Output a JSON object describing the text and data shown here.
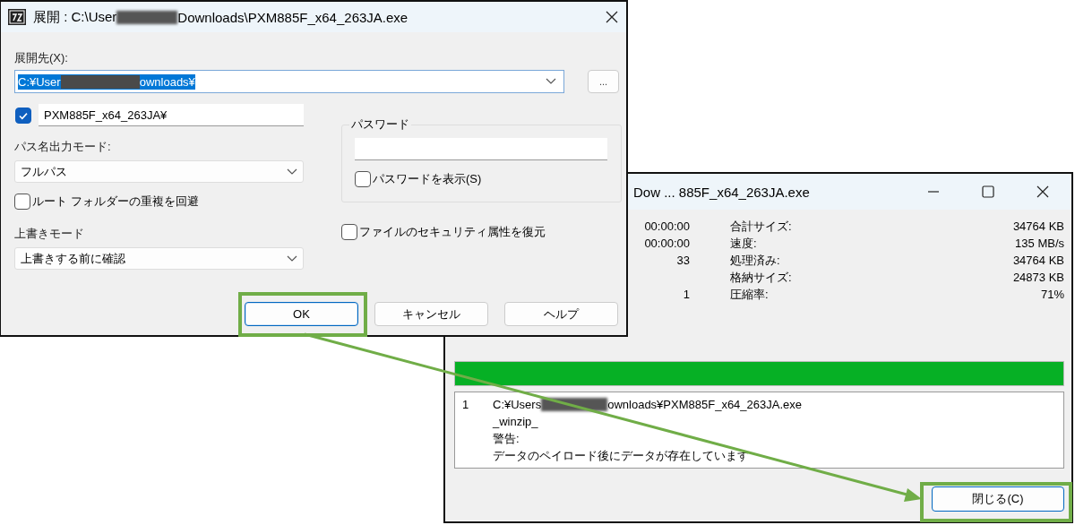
{
  "extract_dialog": {
    "title_parts": [
      "展開 : C:\\User",
      "Downloads\\PXM885F_x64_263JA.exe"
    ],
    "destination_label": "展開先(X):",
    "destination": {
      "value_parts": [
        "C:¥User",
        "ownloads¥"
      ],
      "text_selected": true
    },
    "browse_button": "...",
    "subfolder": {
      "checked": true,
      "value": "PXM885F_x64_263JA¥"
    },
    "path_mode_label": "パス名出力モード:",
    "path_mode": "フルパス",
    "checkboxes": [
      {
        "label": "ルート フォルダーの重複を回避",
        "checked": false
      }
    ],
    "overwrite_label": "上書きモード",
    "overwrite_mode": "上書きする前に確認",
    "password": {
      "legend": "パスワード",
      "show_label": "パスワードを表示(S)",
      "show_checked": false
    },
    "security_checkbox": {
      "label": "ファイルのセキュリティ属性を復元",
      "checked": false
    },
    "buttons": [
      {
        "label": "OK",
        "default": true
      },
      {
        "label": "キャンセル",
        "default": false
      },
      {
        "label": "ヘルプ",
        "default": false
      }
    ]
  },
  "progress_window": {
    "title": "Dow ... 885F_x64_263JA.exe",
    "stats": [
      {
        "value": "00:00:00",
        "label": "合計サイズ:",
        "amount": "34764 KB"
      },
      {
        "value": "00:00:00",
        "label": "速度:",
        "amount": "135 MB/s"
      },
      {
        "value": "33",
        "label": "処理済み:",
        "amount": "34764 KB"
      },
      {
        "label": "格納サイズ:",
        "amount": "24873 KB"
      },
      {
        "value": "1",
        "label": "圧縮率:",
        "amount": "71%"
      }
    ],
    "progress": {
      "level": 1
    },
    "log": {
      "number": "1",
      "path_parts": [
        "C:¥Users",
        "ownloads¥PXM885F_x64_263JA.exe"
      ],
      "lines": [
        "_winzip_",
        "警告:",
        "データのペイロード後にデータが存在しています"
      ]
    },
    "close_button": "閉じる(C)"
  }
}
